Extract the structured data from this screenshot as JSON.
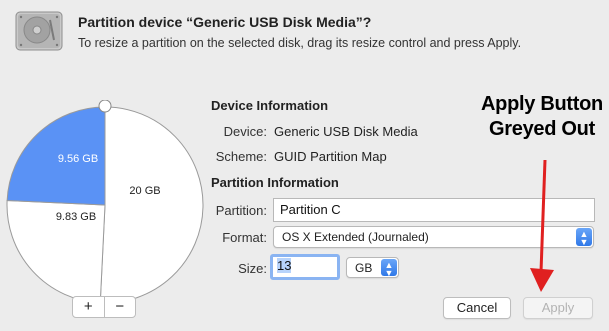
{
  "dialog": {
    "title": "Partition device “Generic USB Disk Media”?",
    "subtitle": "To resize a partition on the selected disk, drag its resize control and press Apply."
  },
  "pie": {
    "slices": [
      {
        "label": "9.56 GB",
        "value": 9.56,
        "color": "#5a92f5",
        "selected": true
      },
      {
        "label": "20 GB",
        "value": 20,
        "color": "#ffffff",
        "selected": false
      },
      {
        "label": "9.83 GB",
        "value": 9.83,
        "color": "#ffffff",
        "selected": false
      }
    ]
  },
  "device_info": {
    "heading": "Device Information",
    "device_label": "Device:",
    "device_value": "Generic USB Disk Media",
    "scheme_label": "Scheme:",
    "scheme_value": "GUID Partition Map"
  },
  "partition_info": {
    "heading": "Partition Information",
    "partition_label": "Partition:",
    "partition_value": "Partition C",
    "format_label": "Format:",
    "format_value": "OS X Extended (Journaled)",
    "size_label": "Size:",
    "size_value": "13",
    "size_unit": "GB"
  },
  "buttons": {
    "add": "+",
    "remove": "−",
    "cancel": "Cancel",
    "apply": "Apply"
  },
  "annotation": {
    "line1": "Apply Button",
    "line2": "Greyed Out",
    "color": "#e02020"
  },
  "icons": {
    "disk": "hard-disk-icon",
    "popup_arrows": "updown-chevron-icon",
    "annotation_arrow": "red-down-arrow"
  }
}
